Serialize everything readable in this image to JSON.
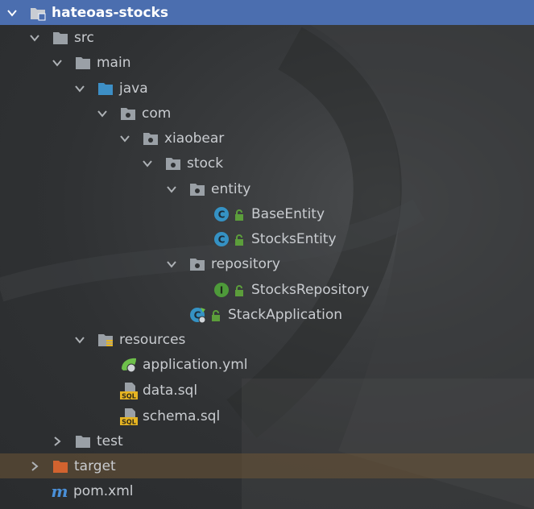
{
  "project_tree": {
    "items": [
      {
        "label": "hateoas-stocks",
        "icon": "module-folder-icon"
      },
      {
        "label": "src",
        "icon": "folder-icon"
      },
      {
        "label": "main",
        "icon": "folder-icon"
      },
      {
        "label": "java",
        "icon": "source-root-folder-icon"
      },
      {
        "label": "com",
        "icon": "package-folder-icon"
      },
      {
        "label": "xiaobear",
        "icon": "package-folder-icon"
      },
      {
        "label": "stock",
        "icon": "package-folder-icon"
      },
      {
        "label": "entity",
        "icon": "package-folder-icon"
      },
      {
        "label": "BaseEntity",
        "icon": "class-icon"
      },
      {
        "label": "StocksEntity",
        "icon": "class-icon"
      },
      {
        "label": "repository",
        "icon": "package-folder-icon"
      },
      {
        "label": "StocksRepository",
        "icon": "interface-icon"
      },
      {
        "label": "StackApplication",
        "icon": "spring-boot-class-icon"
      },
      {
        "label": "resources",
        "icon": "resources-folder-icon"
      },
      {
        "label": "application.yml",
        "icon": "spring-config-icon"
      },
      {
        "label": "data.sql",
        "icon": "sql-file-icon"
      },
      {
        "label": "schema.sql",
        "icon": "sql-file-icon"
      },
      {
        "label": "test",
        "icon": "folder-icon"
      },
      {
        "label": "target",
        "icon": "excluded-folder-icon"
      },
      {
        "label": "pom.xml",
        "icon": "maven-icon"
      }
    ]
  },
  "colors": {
    "selection": "#4b6eaf",
    "highlight_row": "#5e4a35",
    "folder": "#9aa0a6",
    "source_folder": "#3d8fc6",
    "excluded_folder": "#d2632f",
    "class_badge": "#3592c4",
    "interface_badge": "#4e9a3a",
    "lock": "#5c9e3b",
    "sql_badge": "#e6b422",
    "maven": "#4a90d9"
  }
}
